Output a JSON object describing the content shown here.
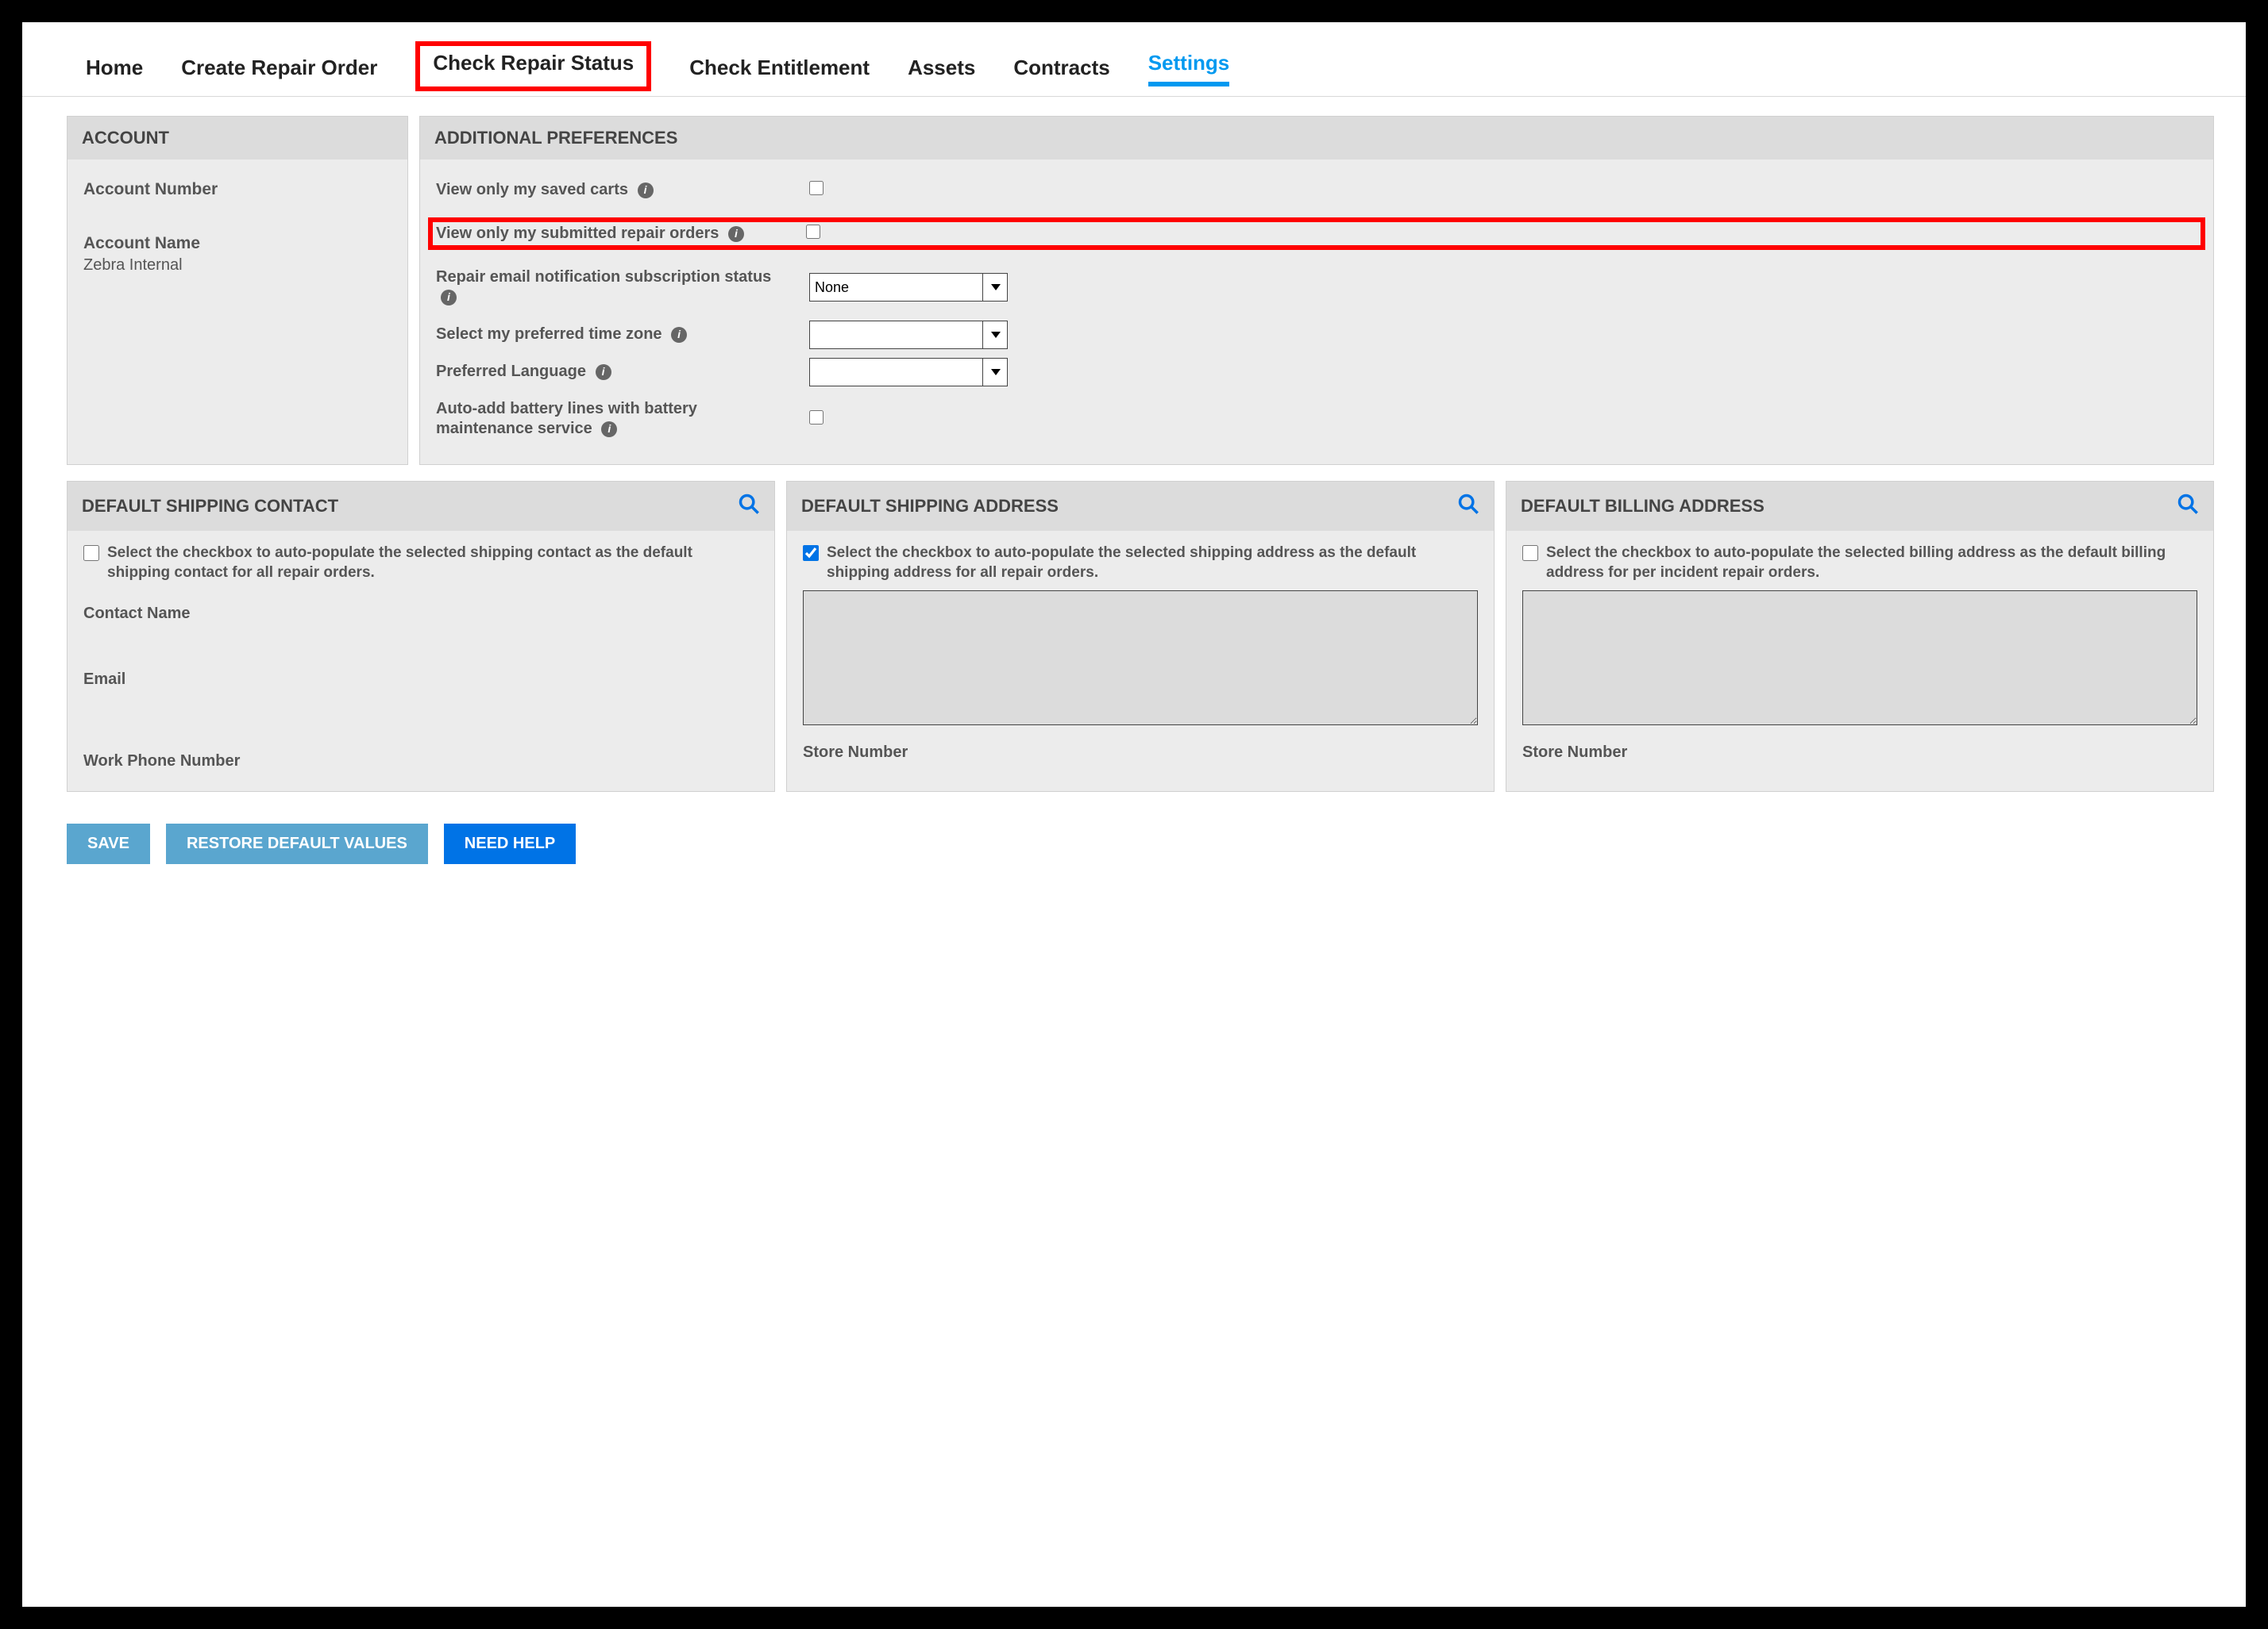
{
  "tabs": {
    "home": "Home",
    "create": "Create Repair Order",
    "check_status": "Check Repair Status",
    "check_ent": "Check Entitlement",
    "assets": "Assets",
    "contracts": "Contracts",
    "settings": "Settings"
  },
  "account": {
    "header": "ACCOUNT",
    "number_label": "Account Number",
    "name_label": "Account Name",
    "name_value": "Zebra Internal"
  },
  "prefs": {
    "header": "ADDITIONAL PREFERENCES",
    "saved_carts": "View only my saved carts",
    "submitted_orders": "View only my submitted repair orders",
    "email_sub": "Repair email notification subscription status",
    "email_sub_value": "None",
    "timezone": "Select my preferred time zone",
    "language": "Preferred Language",
    "battery": "Auto-add battery lines with battery maintenance service"
  },
  "shipping_contact": {
    "header": "DEFAULT SHIPPING CONTACT",
    "desc": "Select the checkbox to auto-populate the selected shipping contact as the default shipping contact for all repair orders.",
    "contact_name": "Contact Name",
    "email": "Email",
    "phone": "Work Phone Number"
  },
  "shipping_address": {
    "header": "DEFAULT SHIPPING ADDRESS",
    "desc": "Select the checkbox to auto-populate the selected shipping address as the default shipping address for all repair orders.",
    "store_number": "Store Number"
  },
  "billing_address": {
    "header": "DEFAULT BILLING ADDRESS",
    "desc": "Select the checkbox to auto-populate the selected billing address as the default billing address for per incident repair orders.",
    "store_number": "Store Number"
  },
  "buttons": {
    "save": "SAVE",
    "restore": "RESTORE DEFAULT VALUES",
    "help": "NEED HELP"
  }
}
